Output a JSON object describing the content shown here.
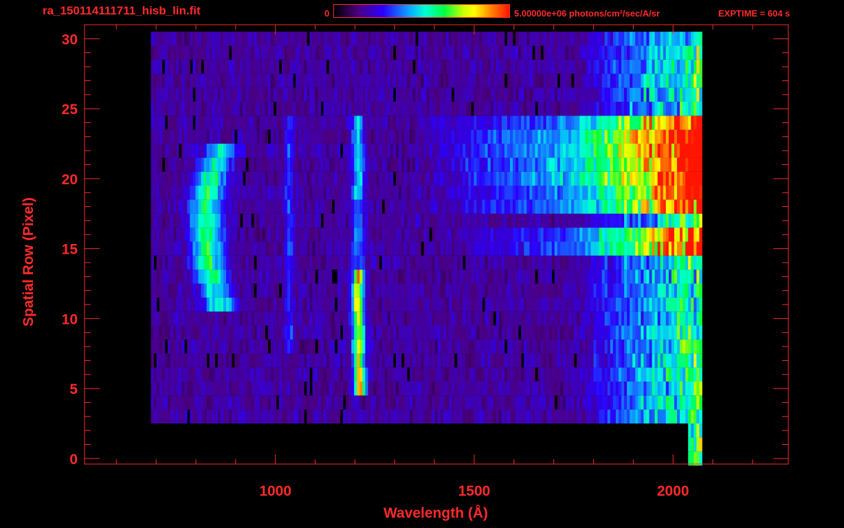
{
  "header": {
    "file_title": "ra_150114111711_hisb_lin.fit",
    "colorbar_min": "0",
    "colorbar_max_units": "5.00000e+06 photons/cm²/sec/A/sr",
    "exptime": "EXPTIME = 604 s"
  },
  "colors": {
    "accent": "#ff2a2a",
    "background": "#000000"
  },
  "chart_data": {
    "type": "heatmap",
    "title": "ra_150114111711_hisb_lin.fit",
    "xlabel": "Wavelength (Å)",
    "ylabel": "Spatial Row (Pixel)",
    "xlim": [
      520,
      2290
    ],
    "ylim": [
      -0.4,
      31.0
    ],
    "x_ticks": [
      1000,
      1500,
      2000
    ],
    "x_tick_labels": [
      "1000",
      "1500",
      "2000"
    ],
    "y_ticks": [
      0,
      5,
      10,
      15,
      20,
      25,
      30
    ],
    "y_tick_labels": [
      "0",
      "5",
      "10",
      "15",
      "20",
      "25",
      "30"
    ],
    "colorbar": {
      "min": 0,
      "max": 5000000,
      "units": "photons/cm²/sec/A/sr"
    },
    "features": [
      {
        "name": "arc emission",
        "x_range": [
          800,
          900
        ],
        "y_range": [
          11,
          22
        ]
      },
      {
        "name": "Lyman-alpha line",
        "x": 1216,
        "y_range": [
          5,
          24
        ]
      },
      {
        "name": "continuum band",
        "x_range": [
          1600,
          2070
        ],
        "y_range": [
          15,
          24
        ]
      }
    ]
  }
}
